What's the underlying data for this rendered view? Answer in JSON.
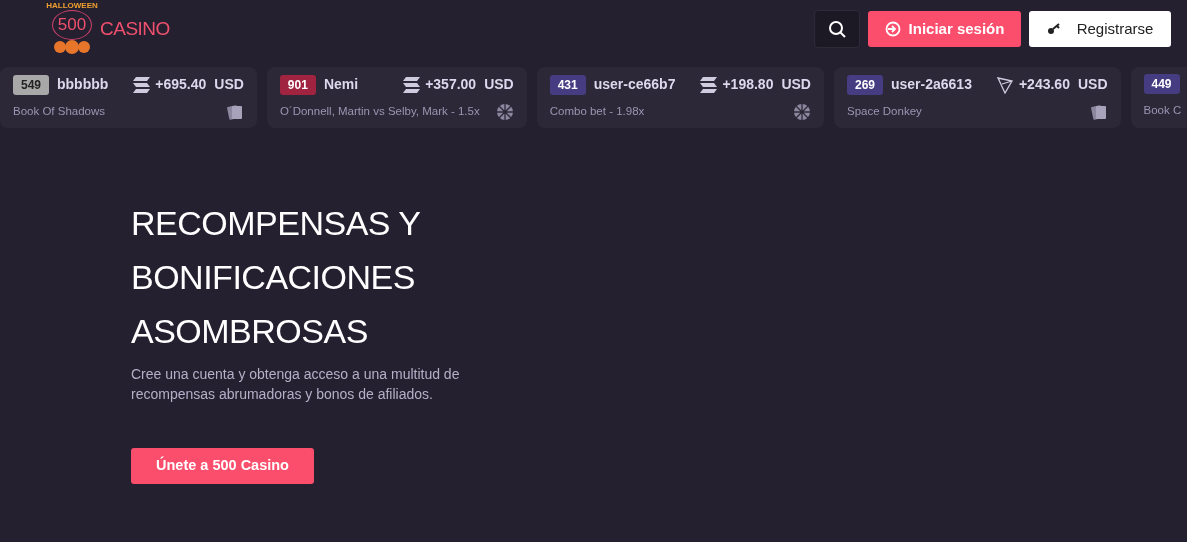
{
  "header": {
    "logo": {
      "banner": "HALLOWEEN",
      "number": "500",
      "name": "CASINO"
    },
    "buttons": [
      {
        "kind": "search"
      },
      {
        "kind": "login",
        "label": "Iniciar sesión"
      },
      {
        "kind": "register",
        "label": "Registrarse"
      }
    ]
  },
  "bets": [
    {
      "rank": "549",
      "color": "#a8a8a8",
      "user": "bbbbbb",
      "coin_icon": {
        "kind": "stripes"
      },
      "amount": "+695.40",
      "unit": "USD",
      "game": "Book Of Shadows",
      "game_icon": {
        "kind": "cards"
      }
    },
    {
      "rank": "901",
      "color": "#a0243f",
      "user": "Nemi",
      "coin_icon": {
        "kind": "stripes"
      },
      "amount": "+357.00",
      "unit": "USD",
      "game": "O´Donnell, Martin vs Selby, Mark - 1.5x",
      "game_icon": {
        "kind": "ball"
      }
    },
    {
      "rank": "431",
      "color": "#463c82",
      "user": "user-ce66b7",
      "coin_icon": {
        "kind": "stripes"
      },
      "amount": "+198.80",
      "unit": "USD",
      "game": "Combo bet - 1.98x",
      "game_icon": {
        "kind": "ball"
      }
    },
    {
      "rank": "269",
      "color": "#463c82",
      "user": "user-2a6613",
      "coin_icon": {
        "kind": "triangle"
      },
      "amount": "+243.60",
      "unit": "USD",
      "game": "Space Donkey",
      "game_icon": {
        "kind": "cards"
      }
    },
    {
      "rank": "449",
      "color": "#463c82",
      "game": "Book C"
    }
  ],
  "hero": {
    "title": "RECOMPENSAS Y BONIFICACIONES ASOMBROSAS",
    "text": "Cree una cuenta y obtenga acceso a una multitud de recompensas abrumadoras y bonos de afiliados.",
    "button": "Únete a 500 Casino"
  }
}
